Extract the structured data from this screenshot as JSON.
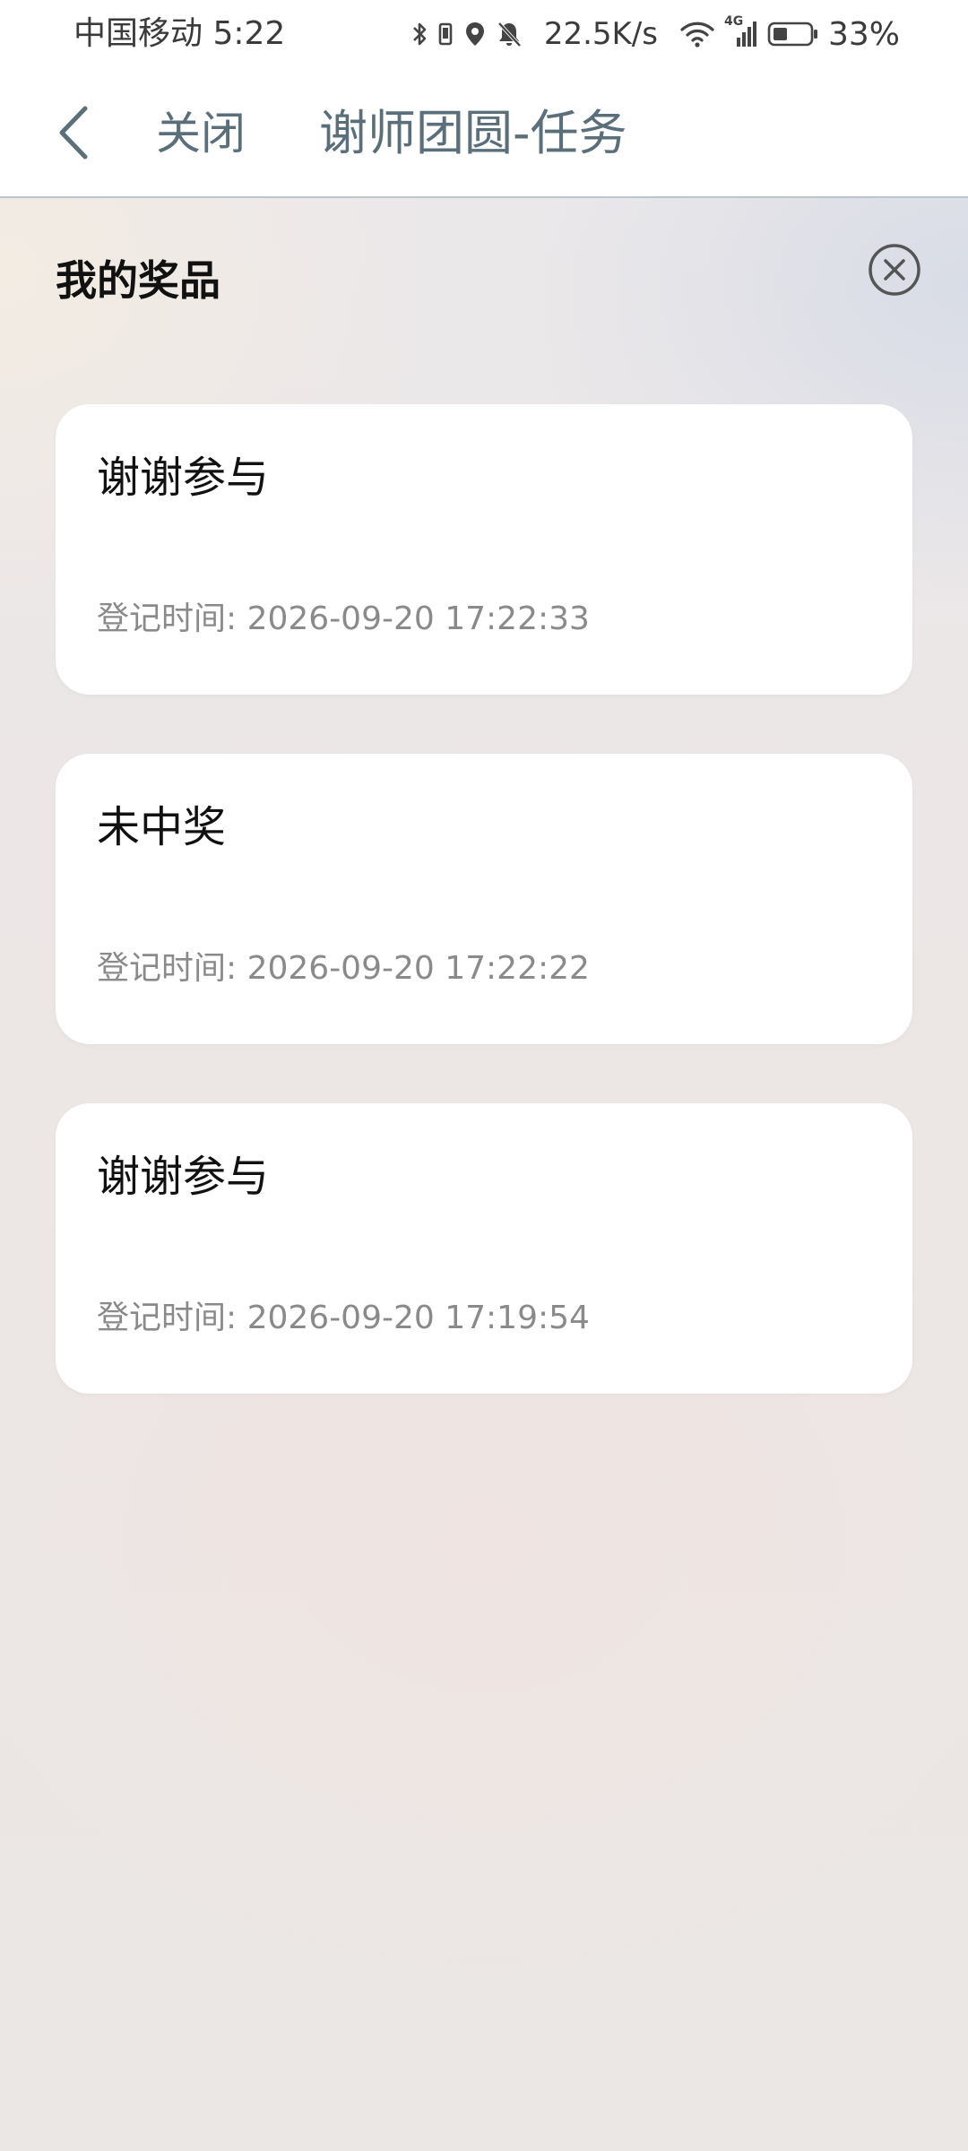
{
  "status_bar": {
    "carrier": "中国移动",
    "time": "5:22",
    "net_speed": "22.5K/s",
    "network_type": "4G",
    "battery": "33%",
    "icons": [
      "bluetooth-icon",
      "vibrate-icon",
      "location-icon",
      "mute-icon",
      "wifi-icon",
      "signal-icon",
      "battery-icon"
    ]
  },
  "nav": {
    "back_icon": "chevron-left-icon",
    "close_label": "关闭",
    "title": "谢师团圆-任务"
  },
  "panel": {
    "title": "我的奖品",
    "close_icon": "circle-close-icon"
  },
  "prizes": [
    {
      "name": "谢谢参与",
      "time": "登记时间: 2026-09-20 17:22:33"
    },
    {
      "name": "未中奖",
      "time": "登记时间: 2026-09-20 17:22:22"
    },
    {
      "name": "谢谢参与",
      "time": "登记时间: 2026-09-20 17:19:54"
    }
  ],
  "colors": {
    "nav_text": "#5b6f7b",
    "card_bg": "#ffffff",
    "time_text": "#8a8a8a"
  }
}
